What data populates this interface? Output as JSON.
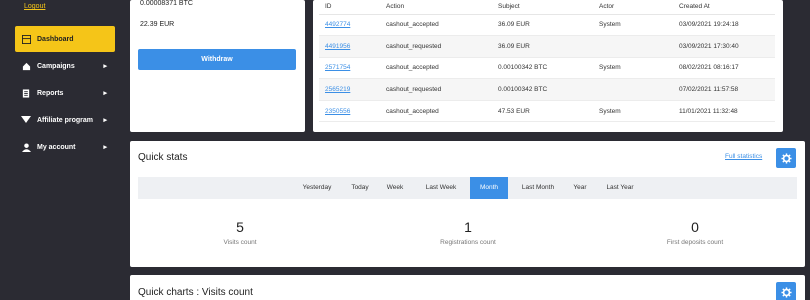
{
  "sidebar": {
    "logout_label": "Logout",
    "items": [
      {
        "label": "Dashboard",
        "icon": "dashboard-icon"
      },
      {
        "label": "Campaigns",
        "icon": "home-icon"
      },
      {
        "label": "Reports",
        "icon": "document-icon"
      },
      {
        "label": "Affiliate program",
        "icon": "heart-icon"
      },
      {
        "label": "My account",
        "icon": "user-icon"
      }
    ]
  },
  "balance": {
    "btc": "0.00008371 BTC",
    "eur": "22.39 EUR",
    "withdraw_label": "Withdraw"
  },
  "transactions": {
    "headers": [
      "ID",
      "Action",
      "Subject",
      "Actor",
      "Created At"
    ],
    "rows": [
      {
        "id": "4492774",
        "action": "cashout_accepted",
        "subject": "36.09 EUR",
        "actor": "System",
        "created": "03/09/2021 19:24:18"
      },
      {
        "id": "4491956",
        "action": "cashout_requested",
        "subject": "36.09 EUR",
        "actor": "",
        "created": "03/09/2021 17:30:40"
      },
      {
        "id": "2571754",
        "action": "cashout_accepted",
        "subject": "0.00100342 BTC",
        "actor": "System",
        "created": "08/02/2021 08:16:17"
      },
      {
        "id": "2565219",
        "action": "cashout_requested",
        "subject": "0.00100342 BTC",
        "actor": "",
        "created": "07/02/2021 11:57:58"
      },
      {
        "id": "2350556",
        "action": "cashout_accepted",
        "subject": "47.53 EUR",
        "actor": "System",
        "created": "11/01/2021 11:32:48"
      }
    ]
  },
  "quick_stats": {
    "title": "Quick stats",
    "full_link": "Full statistics",
    "periods": [
      "Yesterday",
      "Today",
      "Week",
      "Last Week",
      "Month",
      "Last Month",
      "Year",
      "Last Year"
    ],
    "active_period": "Month",
    "stats": [
      {
        "value": "5",
        "label": "Visits count"
      },
      {
        "value": "1",
        "label": "Registrations count"
      },
      {
        "value": "0",
        "label": "First deposits count"
      }
    ]
  },
  "quick_charts": {
    "title": "Quick charts : Visits count"
  },
  "colors": {
    "accent": "#3b8fe6",
    "active_nav": "#f5c518",
    "sidebar_bg": "#2b2b33"
  }
}
